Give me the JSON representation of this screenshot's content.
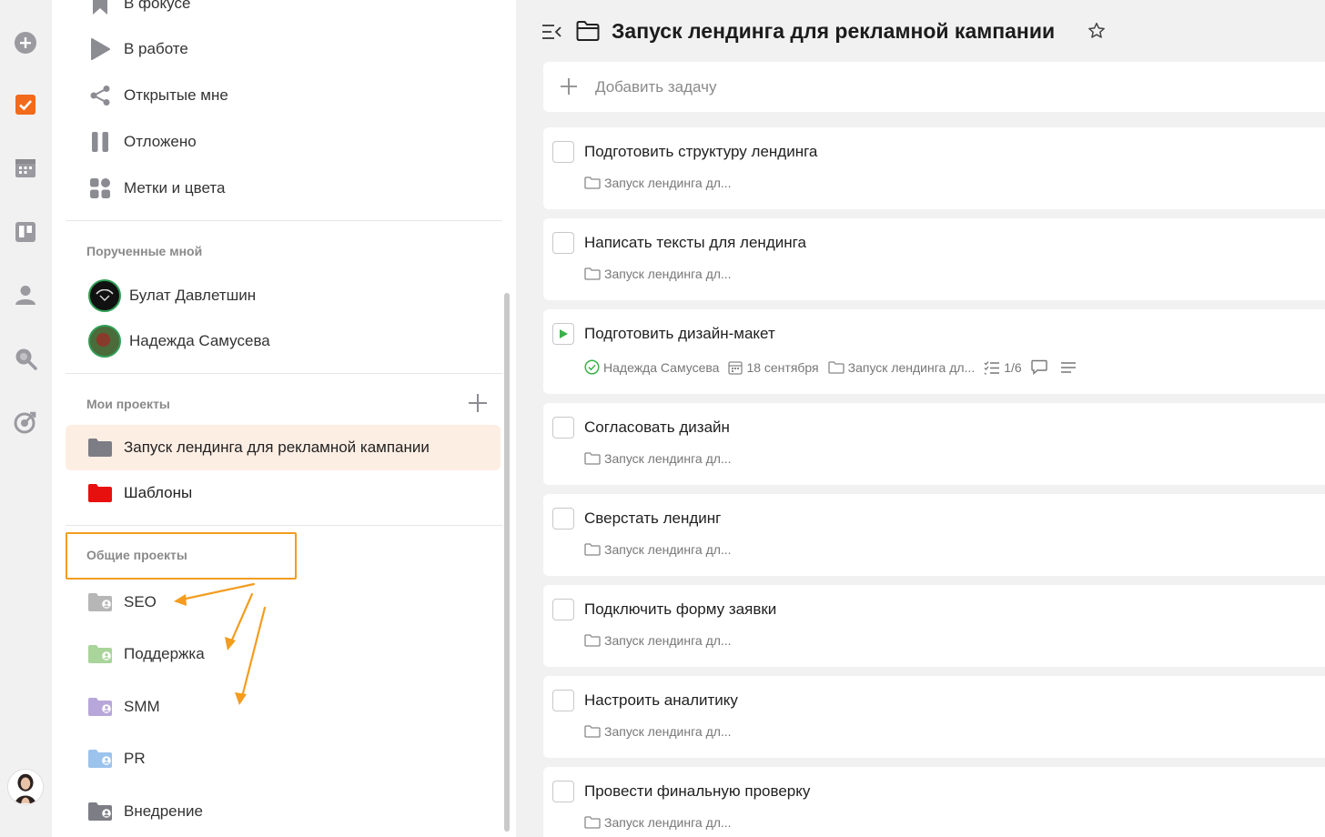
{
  "sidebar": {
    "nav": [
      {
        "label": "В фокусе",
        "icon": "bookmark-icon"
      },
      {
        "label": "В работе",
        "icon": "play-icon"
      },
      {
        "label": "Открытые мне",
        "icon": "share-icon"
      },
      {
        "label": "Отложено",
        "icon": "pause-icon"
      },
      {
        "label": "Метки и цвета",
        "icon": "tags-grid-icon"
      }
    ],
    "assigned_title": "Порученные мной",
    "people": [
      {
        "name": "Булат Давлетшин"
      },
      {
        "name": "Надежда Самусева"
      }
    ],
    "my_projects_title": "Мои проекты",
    "my_projects": [
      {
        "label": "Запуск лендинга для рекламной кампании",
        "color": "#7d7d85"
      },
      {
        "label": "Шаблоны",
        "color": "#e8100f"
      }
    ],
    "shared_title": "Общие проекты",
    "shared_projects": [
      {
        "label": "SEO",
        "color": "#b6b6b6"
      },
      {
        "label": "Поддержка",
        "color": "#a9d49a"
      },
      {
        "label": "SMM",
        "color": "#b7a6d9"
      },
      {
        "label": "PR",
        "color": "#9cc3ec"
      },
      {
        "label": "Внедрение",
        "color": "#7d7d85"
      }
    ]
  },
  "main": {
    "title": "Запуск лендинга для рекламной кампании",
    "add_task_placeholder": "Добавить задачу",
    "tasks": [
      {
        "name": "Подготовить структуру лендинга",
        "project": "Запуск лендинга дл..."
      },
      {
        "name": "Написать тексты для лендинга",
        "project": "Запуск лендинга дл..."
      },
      {
        "name": "Подготовить дизайн-макет",
        "assignee": "Надежда Самусева",
        "date": "18 сентября",
        "project": "Запуск лендинга дл...",
        "checklist": "1/6",
        "in_progress": true
      },
      {
        "name": "Согласовать дизайн",
        "project": "Запуск лендинга дл..."
      },
      {
        "name": "Сверстать лендинг",
        "project": "Запуск лендинга дл..."
      },
      {
        "name": "Подключить форму заявки",
        "project": "Запуск лендинга дл..."
      },
      {
        "name": "Настроить аналитику",
        "project": "Запуск лендинга дл..."
      },
      {
        "name": "Провести финальную проверку",
        "project": "Запуск лендинга дл..."
      }
    ]
  },
  "colors": {
    "accent": "#f26a1b",
    "active_project_bg": "#fdeee4",
    "highlight": "#f39c1f",
    "in_progress": "#3cb149"
  }
}
